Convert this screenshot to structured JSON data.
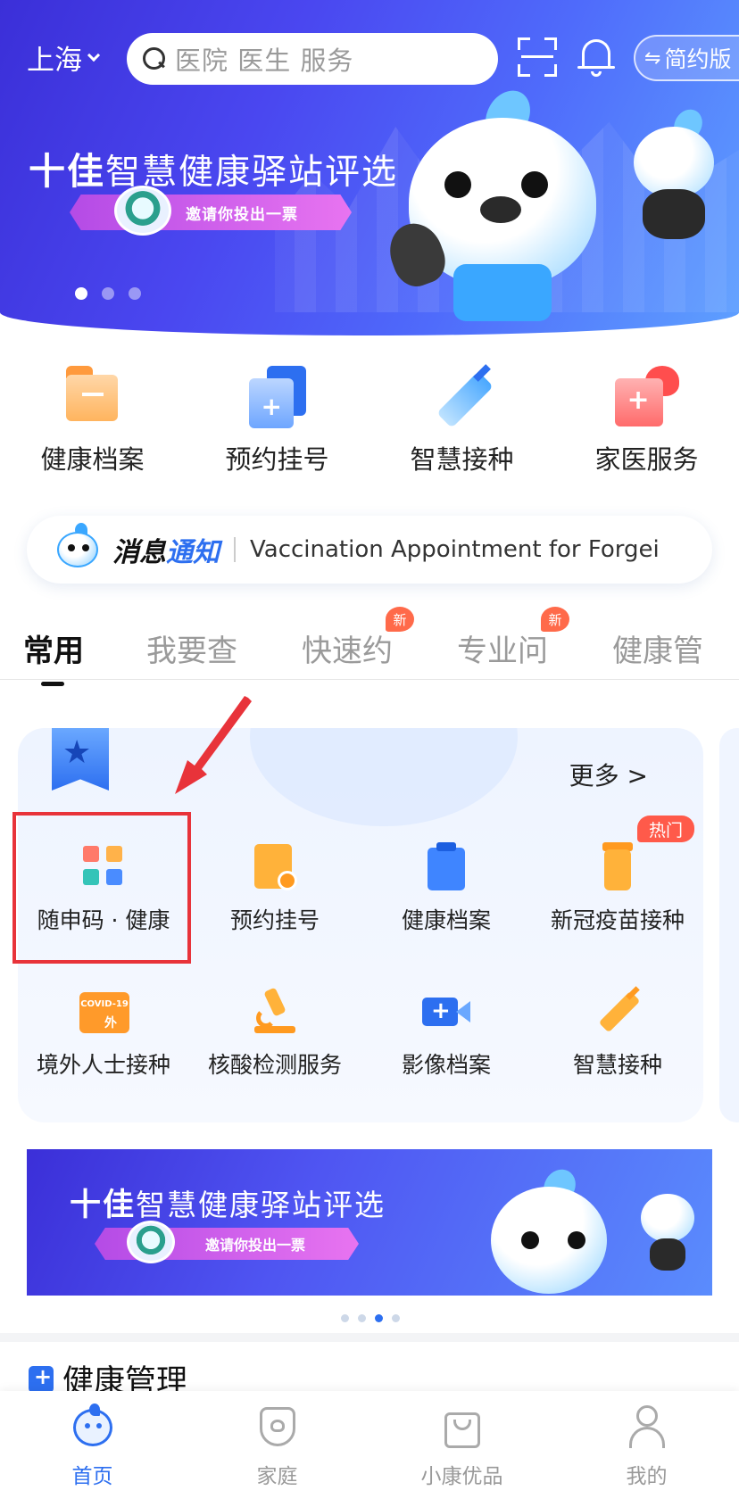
{
  "header": {
    "city": "上海",
    "search_placeholder": "医院 医生 服务",
    "simple_mode_label": "简约版",
    "simple_mode_icon": "⇋"
  },
  "hero_banner": {
    "title_bold": "十佳",
    "title_rest": "智慧健康驿站评选",
    "ribbon_text": "邀请你投出一票",
    "slide_count": 3,
    "active_slide": 0
  },
  "quick_actions": [
    {
      "label": "健康档案",
      "icon": "folder-icon"
    },
    {
      "label": "预约挂号",
      "icon": "register-icon"
    },
    {
      "label": "智慧接种",
      "icon": "syringe-icon"
    },
    {
      "label": "家医服务",
      "icon": "family-doctor-icon"
    }
  ],
  "notice": {
    "tag_part1": "消息",
    "tag_part2": "通知",
    "message": "Vaccination Appointment for Forgei..."
  },
  "tabs": [
    {
      "label": "常用",
      "active": true,
      "badge": ""
    },
    {
      "label": "我要查",
      "active": false,
      "badge": ""
    },
    {
      "label": "快速约",
      "active": false,
      "badge": "新"
    },
    {
      "label": "专业问",
      "active": false,
      "badge": "新"
    },
    {
      "label": "健康管",
      "active": false,
      "badge": ""
    }
  ],
  "services": {
    "more_label": "更多 >",
    "hot_badge": "热门",
    "items": [
      {
        "label": "随申码 · 健康",
        "icon": "qr-code-icon"
      },
      {
        "label": "预约挂号",
        "icon": "appointment-icon"
      },
      {
        "label": "健康档案",
        "icon": "clipboard-icon"
      },
      {
        "label": "新冠疫苗接种",
        "icon": "vaccine-vial-icon"
      },
      {
        "label": "境外人士接种",
        "icon": "covid-passport-icon"
      },
      {
        "label": "核酸检测服务",
        "icon": "microscope-icon"
      },
      {
        "label": "影像档案",
        "icon": "video-camera-icon"
      },
      {
        "label": "智慧接种",
        "icon": "syringe-icon"
      }
    ],
    "covid_icon_text": "COVID-19",
    "covid_icon_sub": "外"
  },
  "banner2": {
    "title_bold": "十佳",
    "title_rest": "智慧健康驿站评选",
    "ribbon_text": "邀请你投出一票",
    "slide_count": 4,
    "active_slide": 2
  },
  "section": {
    "title": "健康管理"
  },
  "bottom_nav": [
    {
      "label": "首页",
      "active": true
    },
    {
      "label": "家庭",
      "active": false
    },
    {
      "label": "小康优品",
      "active": false
    },
    {
      "label": "我的",
      "active": false
    }
  ],
  "colors": {
    "brand_blue": "#2d6ff0",
    "hero_purple": "#3b2fd8",
    "highlight_red": "#e8333a",
    "badge_orange": "#ff6a4a"
  }
}
